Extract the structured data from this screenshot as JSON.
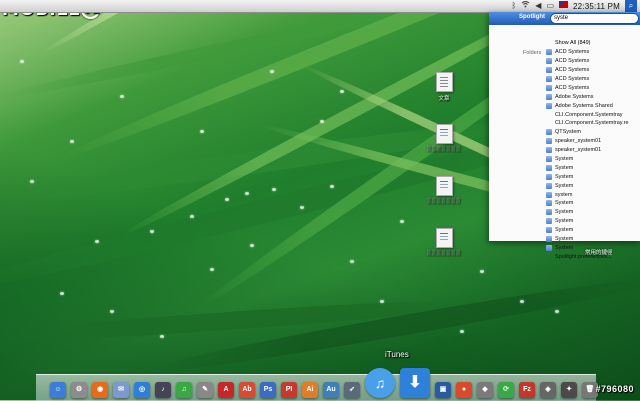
{
  "watermark": {
    "logo_text": "MOBILE",
    "logo_mark": "01",
    "id_text": "#796080"
  },
  "menubar": {
    "icons": [
      "bluetooth-icon",
      "wifi-icon",
      "volume-icon",
      "battery-icon",
      "flag-icon"
    ],
    "clock": "22:35:11 PM",
    "bluetooth_glyph": "ᛒ",
    "volume_glyph": "◀",
    "battery_glyph": "▭",
    "spotlight_glyph": "⌕"
  },
  "spotlight": {
    "title": "Spotlight",
    "query": "syste",
    "section_label": "Folders",
    "results": [
      {
        "label": "Show All (849)",
        "icon": "none"
      },
      {
        "label": "ACD Systems",
        "icon": "folder"
      },
      {
        "label": "ACD Systems",
        "icon": "folder"
      },
      {
        "label": "ACD Systems",
        "icon": "folder"
      },
      {
        "label": "ACD Systems",
        "icon": "folder"
      },
      {
        "label": "ACD Systems",
        "icon": "folder"
      },
      {
        "label": "Adobe Systems",
        "icon": "folder"
      },
      {
        "label": "Adobe Systems Shared",
        "icon": "folder"
      },
      {
        "label": "CLI.Component.Systemtray",
        "icon": "none"
      },
      {
        "label": "CLI.Component.Systemtray.re",
        "icon": "none"
      },
      {
        "label": "QTSystem",
        "icon": "folder"
      },
      {
        "label": "speaker_system01",
        "icon": "folder"
      },
      {
        "label": "speaker_system01",
        "icon": "folder"
      },
      {
        "label": "System",
        "icon": "folder"
      },
      {
        "label": "System",
        "icon": "folder"
      },
      {
        "label": "System",
        "icon": "folder"
      },
      {
        "label": "System",
        "icon": "folder"
      },
      {
        "label": "system",
        "icon": "folder"
      },
      {
        "label": "System",
        "icon": "folder"
      },
      {
        "label": "System",
        "icon": "folder"
      },
      {
        "label": "System",
        "icon": "folder"
      },
      {
        "label": "System",
        "icon": "folder"
      },
      {
        "label": "System",
        "icon": "folder"
      },
      {
        "label": "System",
        "icon": "folder"
      },
      {
        "label": "Spotlight preferences...",
        "icon": "none"
      }
    ]
  },
  "desktop": {
    "icons": [
      {
        "label": "文章",
        "kind": "doc"
      },
      {
        "label": "▒▒▒▒▒▒▒",
        "kind": "doc-blue"
      },
      {
        "label": "▒▒▒▒▒▒▒",
        "kind": "doc-blue"
      },
      {
        "label": "▒▒▒▒▒▒▒",
        "kind": "doc-blue"
      }
    ],
    "side_label": "常用的捷徑"
  },
  "dock": {
    "hover_label": "iTunes",
    "items": [
      {
        "name": "finder",
        "glyph": "☺",
        "color": "#3a7fd5"
      },
      {
        "name": "system-preferences",
        "glyph": "⚙",
        "color": "#8c8c8c"
      },
      {
        "name": "firefox",
        "glyph": "◉",
        "color": "#e66b1b"
      },
      {
        "name": "mail",
        "glyph": "✉",
        "color": "#7a9ad0"
      },
      {
        "name": "safari",
        "glyph": "◎",
        "color": "#2f7fd8"
      },
      {
        "name": "media-app",
        "glyph": "♪",
        "color": "#445"
      },
      {
        "name": "itunes-helper",
        "glyph": "♫",
        "color": "#3aa845"
      },
      {
        "name": "tool-app",
        "glyph": "✎",
        "color": "#888"
      },
      {
        "name": "acrobat",
        "glyph": "A",
        "color": "#c62828"
      },
      {
        "name": "adobe-app",
        "glyph": "Ab",
        "color": "#d84a32"
      },
      {
        "name": "photoshop",
        "glyph": "Ps",
        "color": "#3b6bc2"
      },
      {
        "name": "pdf-app",
        "glyph": "PI",
        "color": "#c5392f"
      },
      {
        "name": "ai-app",
        "glyph": "Ai",
        "color": "#e07d2a"
      },
      {
        "name": "audition",
        "glyph": "Au",
        "color": "#3f7fb8"
      },
      {
        "name": "bird-app",
        "glyph": "➶",
        "color": "#5a6a7a"
      },
      {
        "name": "itunes",
        "glyph": "♫",
        "color": "#4aa0e8"
      },
      {
        "name": "download",
        "glyph": "⬇",
        "color": "#2f80d8"
      },
      {
        "name": "virtualbox",
        "glyph": "▣",
        "color": "#2a5aa0"
      },
      {
        "name": "app-a",
        "glyph": "●",
        "color": "#d84a2a"
      },
      {
        "name": "app-b",
        "glyph": "◆",
        "color": "#7a7a7a"
      },
      {
        "name": "app-c",
        "glyph": "⟳",
        "color": "#3aa845"
      },
      {
        "name": "filezilla",
        "glyph": "Fz",
        "color": "#c0392b"
      },
      {
        "name": "app-d",
        "glyph": "◈",
        "color": "#666"
      },
      {
        "name": "app-e",
        "glyph": "✦",
        "color": "#4a4a4a"
      },
      {
        "name": "trash",
        "glyph": "🗑",
        "color": "#777"
      }
    ]
  },
  "colors": {
    "accent": "#2159b8",
    "grass_dark": "#0d4d1a",
    "grass_light": "#7fb85c"
  }
}
